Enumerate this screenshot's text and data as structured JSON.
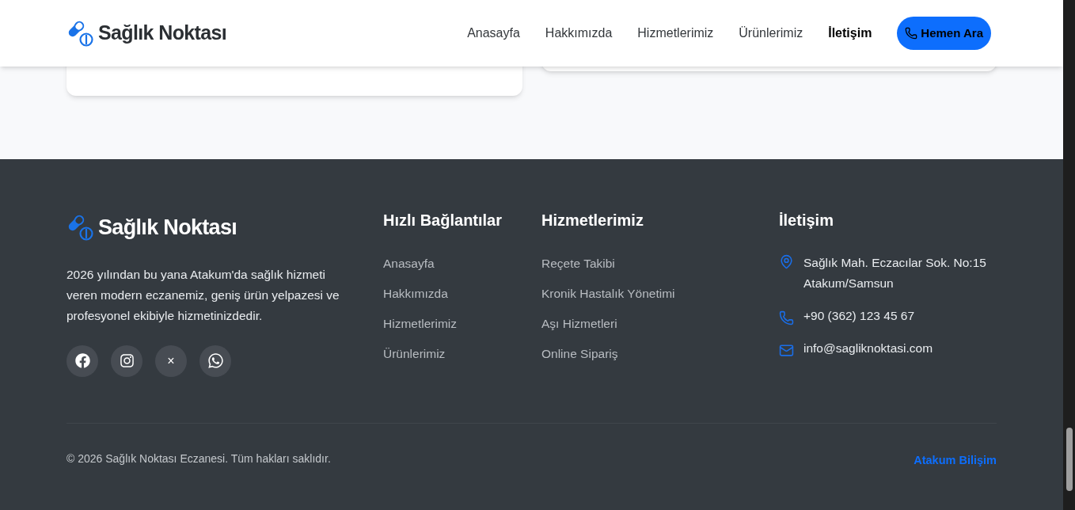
{
  "header": {
    "brand": "Sağlık Noktası",
    "nav": [
      {
        "label": "Anasayfa",
        "selected": false
      },
      {
        "label": "Hakkımızda",
        "selected": false
      },
      {
        "label": "Hizmetlerimiz",
        "selected": false
      },
      {
        "label": "Ürünlerimiz",
        "selected": false
      },
      {
        "label": "İletişim",
        "selected": true
      }
    ],
    "call_button": "Hemen Ara"
  },
  "footer": {
    "brand": "Sağlık Noktası",
    "about": "2026 yılından bu yana Atakum'da sağlık hizmeti veren modern eczanemiz, geniş ürün yelpazesi ve profesyonel ekibiyle hizmetinizdedir.",
    "social": [
      {
        "kind": "facebook"
      },
      {
        "kind": "instagram"
      },
      {
        "kind": "x",
        "label": "×"
      },
      {
        "kind": "whatsapp"
      }
    ],
    "quick_links": {
      "title": "Hızlı Bağlantılar",
      "items": [
        "Anasayfa",
        "Hakkımızda",
        "Hizmetlerimiz",
        "Ürünlerimiz"
      ]
    },
    "services": {
      "title": "Hizmetlerimiz",
      "items": [
        "Reçete Takibi",
        "Kronik Hastalık Yönetimi",
        "Aşı Hizmetleri",
        "Online Sipariş"
      ]
    },
    "contact": {
      "title": "İletişim",
      "items": [
        {
          "kind": "address",
          "lines": [
            "Sağlık Mah. Eczacılar Sok. No:15",
            "Atakum/Samsun"
          ]
        },
        {
          "kind": "phone",
          "lines": [
            "+90 (362) 123 45 67"
          ]
        },
        {
          "kind": "email",
          "lines": [
            "info@sagliknoktasi.com"
          ]
        }
      ]
    },
    "copyright": "© 2026 Sağlık Noktası Eczanesi. Tüm hakları saklıdır.",
    "credit": "Atakum Bilişim"
  }
}
